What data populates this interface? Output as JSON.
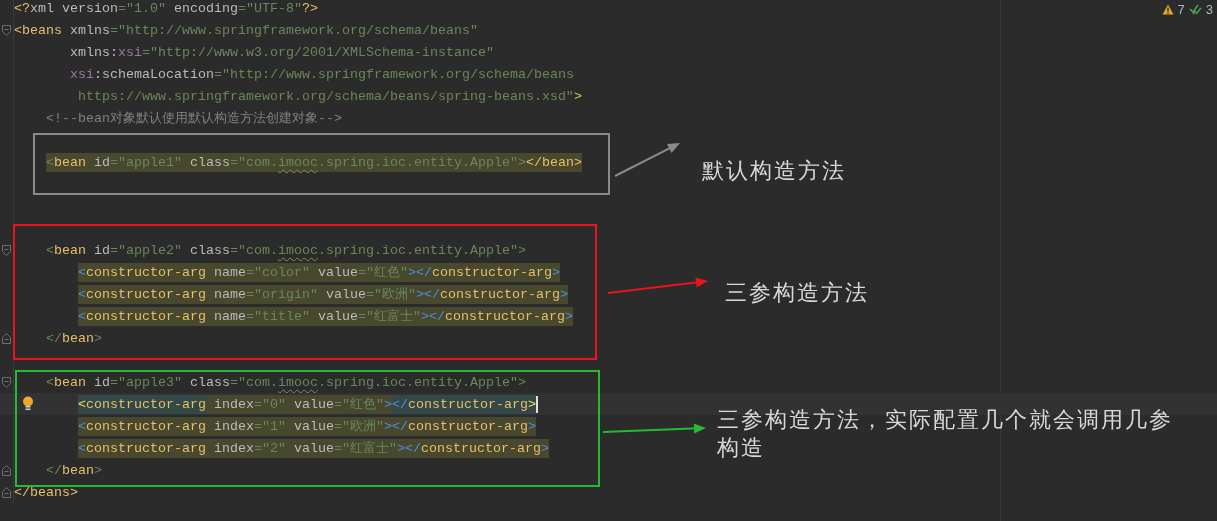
{
  "inspections": {
    "warnings": "7",
    "checks": "3"
  },
  "lines": [
    {
      "kind": "top",
      "tokens": [
        {
          "kind": "tag",
          "text": "<?"
        },
        {
          "kind": "attr-join",
          "text": "xml"
        },
        {
          "kind": "attr",
          "text": "version"
        },
        {
          "kind": "value",
          "text": "=\"1.0\""
        },
        {
          "kind": "attr",
          "text": "encoding"
        },
        {
          "kind": "value",
          "text": "=\"UTF-8\""
        },
        {
          "kind": "tag",
          "text": "?>"
        }
      ]
    },
    {
      "kind": "top",
      "fold_start": true,
      "tokens": [
        {
          "kind": "tag",
          "text": "<beans"
        },
        {
          "kind": "attr",
          "text": "xmlns"
        },
        {
          "kind": "value",
          "text": "=\"http://www.springframework.org/schema/beans\""
        }
      ]
    },
    {
      "kind": "attr-continuation",
      "tokens": [
        {
          "kind": "attr",
          "text": "xmlns:"
        },
        {
          "kind": "ns",
          "text": "xsi"
        },
        {
          "kind": "value",
          "text": "=\"http://www.w3.org/2001/XMLSchema-instance\""
        }
      ]
    },
    {
      "kind": "attr-continuation",
      "tokens": [
        {
          "kind": "ns",
          "text": "xsi"
        },
        {
          "kind": "attr-join",
          "text": ":schemaLocation"
        },
        {
          "kind": "value",
          "text": "=\"http://www.springframework.org/schema/beans"
        }
      ]
    },
    {
      "kind": "value-continuation",
      "tokens": [
        {
          "kind": "value",
          "text": "https://www.springframework.org/schema/beans/spring-beans.xsd\""
        },
        {
          "kind": "tag",
          "text": ">"
        }
      ]
    },
    {
      "kind": "child",
      "tokens": [
        {
          "kind": "comment",
          "text": "<!--bean对象默认使用默认构造方法创建对象-->"
        }
      ]
    },
    {
      "kind": "blank"
    },
    {
      "kind": "child",
      "selected": true,
      "tokens": [
        {
          "kind": "bracket",
          "text": "<"
        },
        {
          "kind": "tag",
          "text": "bean"
        },
        {
          "kind": "attr",
          "text": "id"
        },
        {
          "kind": "value",
          "text": "=\"apple1\""
        },
        {
          "kind": "attr",
          "text": "class"
        },
        {
          "kind": "value",
          "text": "=\"com."
        },
        {
          "kind": "value",
          "text": "imooc",
          "typo": true
        },
        {
          "kind": "value",
          "text": ".spring.ioc.entity.Apple\""
        },
        {
          "kind": "bracket",
          "text": ">"
        },
        {
          "kind": "tag",
          "text": "</bean>"
        }
      ]
    },
    {
      "kind": "blank"
    },
    {
      "kind": "blank"
    },
    {
      "kind": "blank"
    },
    {
      "kind": "child",
      "fold_start": true,
      "tokens": [
        {
          "kind": "bracket",
          "text": "<"
        },
        {
          "kind": "tag",
          "text": "bean"
        },
        {
          "kind": "attr",
          "text": "id"
        },
        {
          "kind": "value",
          "text": "=\"apple2\""
        },
        {
          "kind": "attr",
          "text": "class"
        },
        {
          "kind": "value",
          "text": "=\"com."
        },
        {
          "kind": "value",
          "text": "imooc",
          "typo": true
        },
        {
          "kind": "value",
          "text": ".spring.ioc.entity.Apple\""
        },
        {
          "kind": "bracket",
          "text": ">"
        }
      ]
    },
    {
      "kind": "grandchild",
      "selected": true,
      "tokens": [
        {
          "kind": "blue",
          "text": "<"
        },
        {
          "kind": "tag",
          "text": "constructor-arg"
        },
        {
          "kind": "attr",
          "text": "name"
        },
        {
          "kind": "value",
          "text": "=\"color\""
        },
        {
          "kind": "attr",
          "text": "value"
        },
        {
          "kind": "value",
          "text": "=\"红色\""
        },
        {
          "kind": "blue",
          "text": "></"
        },
        {
          "kind": "tag",
          "text": "constructor-arg"
        },
        {
          "kind": "blue",
          "text": ">"
        }
      ]
    },
    {
      "kind": "grandchild",
      "selected": true,
      "tokens": [
        {
          "kind": "blue",
          "text": "<"
        },
        {
          "kind": "tag",
          "text": "constructor-arg"
        },
        {
          "kind": "attr",
          "text": "name"
        },
        {
          "kind": "value",
          "text": "=\"origin\""
        },
        {
          "kind": "attr",
          "text": "value"
        },
        {
          "kind": "value",
          "text": "=\"欧洲\""
        },
        {
          "kind": "blue",
          "text": "></"
        },
        {
          "kind": "tag",
          "text": "constructor-arg"
        },
        {
          "kind": "blue",
          "text": ">"
        }
      ]
    },
    {
      "kind": "grandchild",
      "selected": true,
      "tokens": [
        {
          "kind": "blue",
          "text": "<"
        },
        {
          "kind": "tag",
          "text": "constructor-arg"
        },
        {
          "kind": "attr",
          "text": "name"
        },
        {
          "kind": "value",
          "text": "=\"title\""
        },
        {
          "kind": "attr",
          "text": "value"
        },
        {
          "kind": "value",
          "text": "=\"红富士\""
        },
        {
          "kind": "blue",
          "text": "></"
        },
        {
          "kind": "tag",
          "text": "constructor-arg"
        },
        {
          "kind": "blue",
          "text": ">"
        }
      ]
    },
    {
      "kind": "child",
      "fold_end": true,
      "tokens": [
        {
          "kind": "bracket",
          "text": "</"
        },
        {
          "kind": "tag",
          "text": "bean"
        },
        {
          "kind": "bracket",
          "text": ">"
        }
      ]
    },
    {
      "kind": "blank"
    },
    {
      "kind": "child",
      "fold_start": true,
      "tokens": [
        {
          "kind": "bracket",
          "text": "<"
        },
        {
          "kind": "tag",
          "text": "bean"
        },
        {
          "kind": "attr",
          "text": "id"
        },
        {
          "kind": "value",
          "text": "=\"apple3\""
        },
        {
          "kind": "attr",
          "text": "class"
        },
        {
          "kind": "value",
          "text": "=\"com."
        },
        {
          "kind": "value",
          "text": "imooc",
          "typo": true
        },
        {
          "kind": "value",
          "text": ".spring.ioc.entity.Apple\""
        },
        {
          "kind": "bracket",
          "text": ">"
        }
      ]
    },
    {
      "kind": "grandchild",
      "selected": true,
      "current": true,
      "intention": true,
      "caret": true,
      "tokens": [
        {
          "kind": "match",
          "text": "<",
          "match": true
        },
        {
          "kind": "tag",
          "text": "constructor-arg",
          "match": true
        },
        {
          "kind": "attr",
          "text": "index"
        },
        {
          "kind": "value",
          "text": "=\"0\""
        },
        {
          "kind": "attr",
          "text": "value"
        },
        {
          "kind": "value",
          "text": "=\"红色\""
        },
        {
          "kind": "blue",
          "text": ">"
        },
        {
          "kind": "blue",
          "text": "</",
          "match": true
        },
        {
          "kind": "tag",
          "text": "constructor-arg",
          "match": true
        },
        {
          "kind": "match",
          "text": ">",
          "match": true
        }
      ]
    },
    {
      "kind": "grandchild",
      "selected": true,
      "tokens": [
        {
          "kind": "blue",
          "text": "<"
        },
        {
          "kind": "tag",
          "text": "constructor-arg"
        },
        {
          "kind": "attr",
          "text": "index"
        },
        {
          "kind": "value",
          "text": "=\"1\""
        },
        {
          "kind": "attr",
          "text": "value"
        },
        {
          "kind": "value",
          "text": "=\"欧洲\""
        },
        {
          "kind": "blue",
          "text": "></"
        },
        {
          "kind": "tag",
          "text": "constructor-arg"
        },
        {
          "kind": "blue",
          "text": ">"
        }
      ]
    },
    {
      "kind": "grandchild",
      "selected": true,
      "tokens": [
        {
          "kind": "blue",
          "text": "<"
        },
        {
          "kind": "tag",
          "text": "constructor-arg"
        },
        {
          "kind": "attr",
          "text": "index"
        },
        {
          "kind": "value",
          "text": "=\"2\""
        },
        {
          "kind": "attr",
          "text": "value"
        },
        {
          "kind": "value",
          "text": "=\"红富士\""
        },
        {
          "kind": "blue",
          "text": "></"
        },
        {
          "kind": "tag",
          "text": "constructor-arg"
        },
        {
          "kind": "blue",
          "text": ">"
        }
      ]
    },
    {
      "kind": "child",
      "fold_end": true,
      "tokens": [
        {
          "kind": "bracket",
          "text": "</"
        },
        {
          "kind": "tag",
          "text": "bean"
        },
        {
          "kind": "bracket",
          "text": ">"
        }
      ]
    },
    {
      "kind": "top",
      "fold_end": true,
      "tokens": [
        {
          "kind": "tag",
          "text": "</beans>"
        }
      ]
    }
  ],
  "annotations": [
    {
      "color": "#8a8a8a",
      "note": "默认构造方法"
    },
    {
      "color": "#e8141e",
      "note": "三参构造方法"
    },
    {
      "color": "#22bb33",
      "note": "三参构造方法，实际配置几个就会调用几参构造"
    }
  ]
}
